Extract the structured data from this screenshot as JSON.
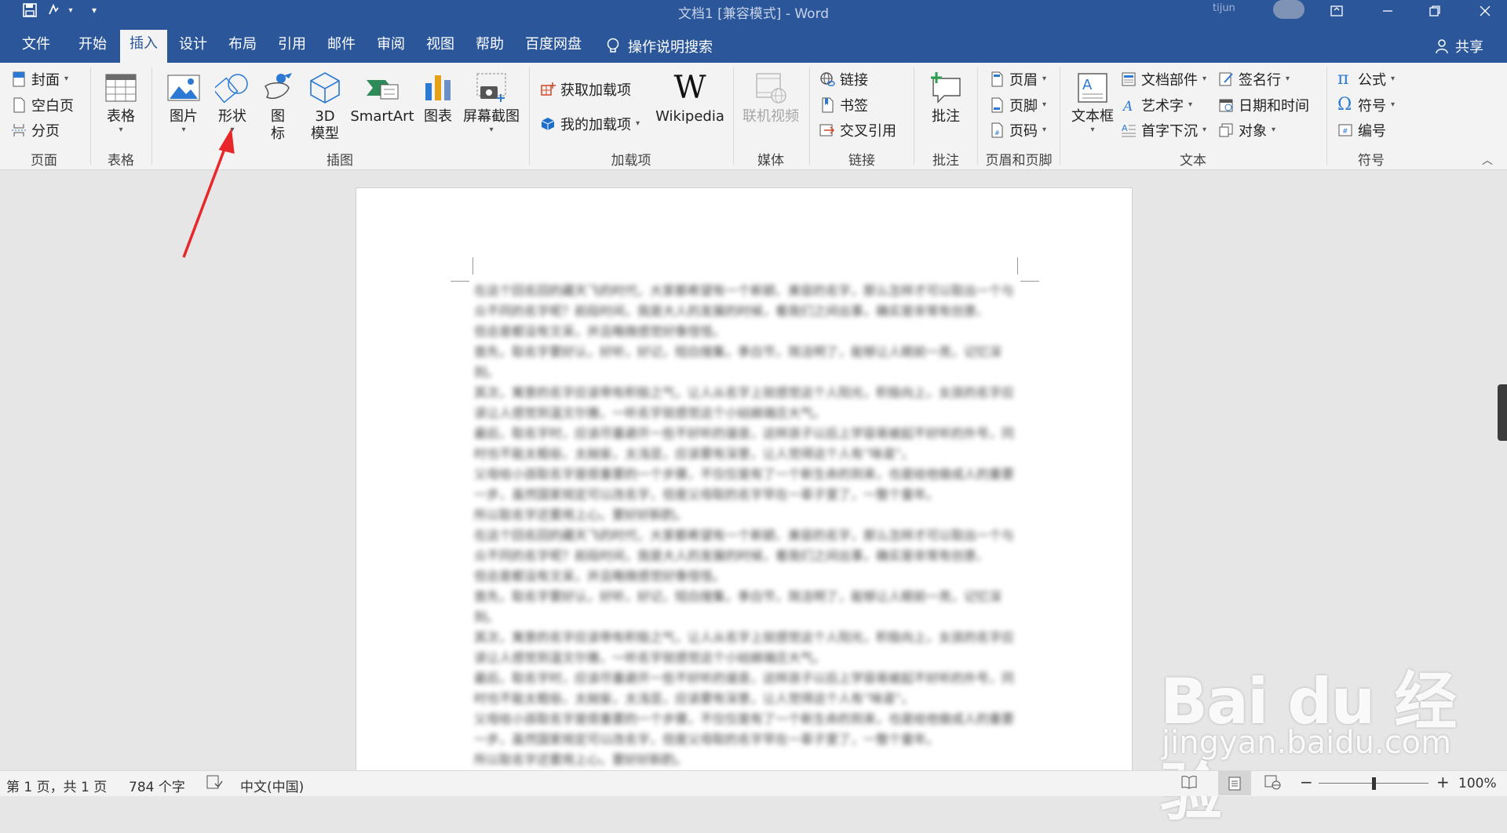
{
  "titlebar": {
    "title": "文档1 [兼容模式] - Word",
    "user": "tijun",
    "quick_access": [
      "save-icon",
      "undo-icon",
      "customize-icon"
    ]
  },
  "tabs": [
    "文件",
    "开始",
    "插入",
    "设计",
    "布局",
    "引用",
    "邮件",
    "审阅",
    "视图",
    "帮助",
    "百度网盘"
  ],
  "active_tab": "插入",
  "tell_me": "操作说明搜索",
  "share": "共享",
  "ribbon": {
    "pages": {
      "cover": "封面",
      "blank": "空白页",
      "break": "分页",
      "group": "页面"
    },
    "table": {
      "table": "表格",
      "group": "表格"
    },
    "illustrations": {
      "picture": "图片",
      "shapes": "形状",
      "icons": "图\n标",
      "model3d": "3D\n模型",
      "smartart": "SmartArt",
      "chart": "图表",
      "screenshot": "屏幕截图",
      "group": "插图"
    },
    "addins": {
      "get": "获取加载项",
      "my": "我的加载项",
      "wikipedia": "Wikipedia",
      "wiki_logo": "W",
      "group": "加载项"
    },
    "media": {
      "online_video": "联机视频",
      "group": "媒体"
    },
    "links": {
      "link": "链接",
      "bookmark": "书签",
      "cross_ref": "交叉引用",
      "group": "链接"
    },
    "comments": {
      "comment": "批注",
      "group": "批注"
    },
    "header_footer": {
      "header": "页眉",
      "footer": "页脚",
      "page_number": "页码",
      "group": "页眉和页脚"
    },
    "text": {
      "textbox": "文本框",
      "quick_parts": "文档部件",
      "wordart": "艺术字",
      "drop_cap": "首字下沉",
      "signature": "签名行",
      "datetime": "日期和时间",
      "object": "对象",
      "group": "文本"
    },
    "symbols": {
      "equation": "公式",
      "symbol": "符号",
      "number": "编号",
      "group": "符号"
    }
  },
  "document": {
    "paragraphs": [
      "在这个回名回的藏天飞的时代，大家都希望有一个新颖、美容的名字，那么怎样才可以取出一个与众不同的名字呢？前段时间，我是大人的发展的时候，看我们之间出事，确实是非常有创意、",
      "但总是都没有文采，并且略微感觉好像怪怪。",
      "首先，取名字要好认，好听，好记，短白搜集，季白节，简洁明了，能够让人眼前一亮，记忆深刻。",
      "其次，寓意的名字应该带有积极之气，让人从名字上就感觉这个人阳光，积极向上，女孩的名字应该让人感觉到温文尔雅，一听名字就感觉这个小姑娘端庄大气。",
      "最后，取名字时，应该尽量避开一些不好听的谐音，这样孩子以后上学容易被起不好听的外号，同时也不能太粗俗，太拗妄，太浅显，应该要有深意，让人觉得这个人有“味道”。",
      "父母给小孩取名字是很重要的一个步骤，不仅仅是有了一个新生命的到来，也是给他做成人的重要一步，虽然国家规定可以改名字，但是父母取的名字早在一辈子里了，一整个童年。",
      "所以取名字还要用上心。要好好斟酌。",
      "在这个回名回的藏天飞的时代，大家都希望有一个新颖、美容的名字，那么怎样才可以取出一个与众不同的名字呢？前段时间，我是大人的发展的时候，看我们之间出事，确实是非常有创意、",
      "但总是都没有文采，并且略微感觉好像怪怪。",
      "首先，取名字要好认，好听，好记，短白搜集，季白节，简洁明了，能够让人眼前一亮，记忆深刻。",
      "其次，寓意的名字应该带有积极之气，让人从名字上就感觉这个人阳光，积极向上，女孩的名字应该让人感觉到温文尔雅，一听名字就感觉这个小姑娘端庄大气。",
      "最后，取名字时，应该尽量避开一些不好听的谐音，这样孩子以后上学容易被起不好听的外号，同时也不能太粗俗，太拗妄，太浅显，应该要有深意，让人觉得这个人有“味道”。",
      "父母给小孩取名字是很重要的一个步骤，不仅仅是有了一个新生命的到来，也是给他做成人的重要一步，虽然国家规定可以改名字，但是父母取的名字早在一辈子里了，一整个童年。",
      "所以取名字还要用上心。要好好斟酌。"
    ]
  },
  "statusbar": {
    "page": "第 1 页，共 1 页",
    "words": "784 个字",
    "language": "中文(中国)",
    "zoom": "100%",
    "zoom_minus": "−",
    "zoom_plus": "+"
  },
  "watermark": {
    "logo": "Bai du 经验",
    "url": "jingyan.baidu.com"
  },
  "colors": {
    "accent": "#2b579a",
    "ribbon": "#f3f3f3",
    "annotation": "#e8272b"
  }
}
